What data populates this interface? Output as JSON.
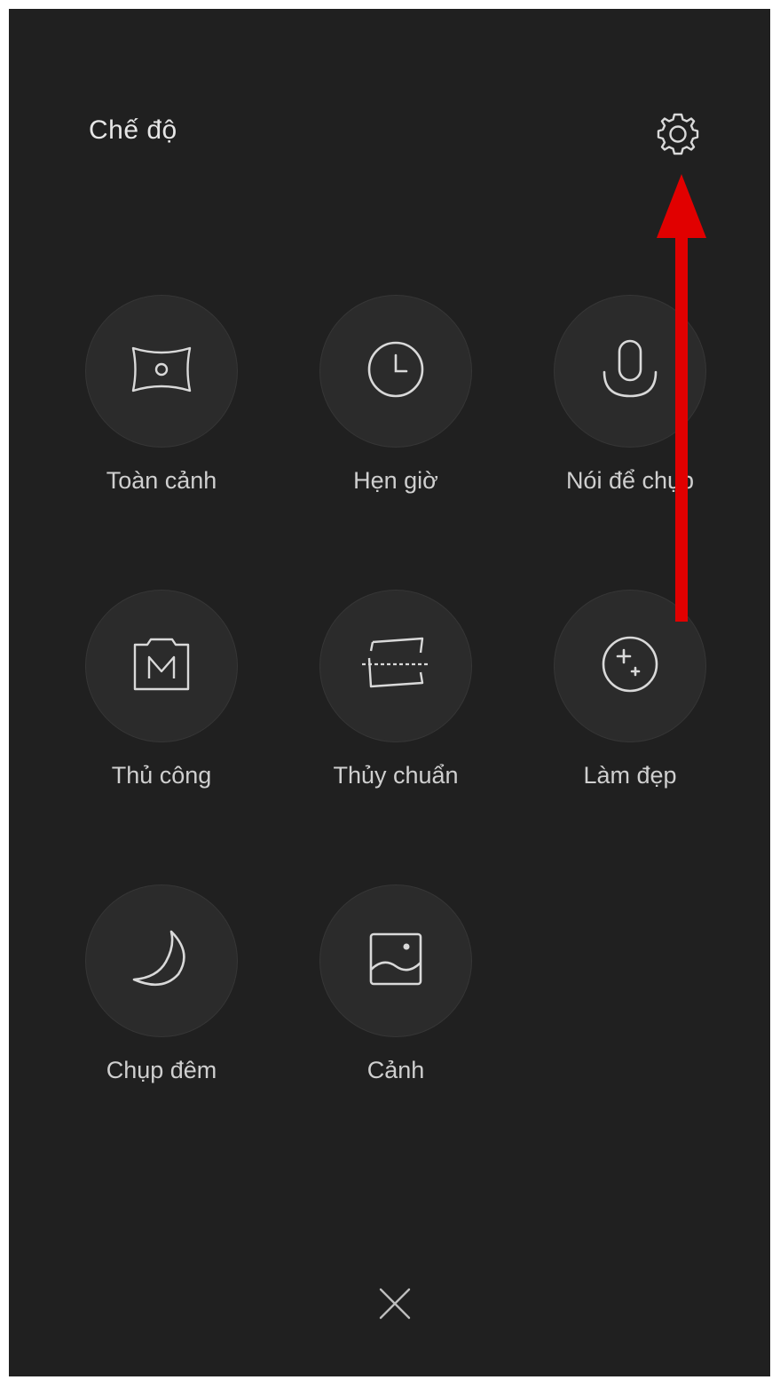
{
  "header": {
    "title": "Chế độ",
    "settings_icon": "gear-icon"
  },
  "modes": [
    {
      "label": "Toàn cảnh",
      "icon": "panorama-icon"
    },
    {
      "label": "Hẹn giờ",
      "icon": "clock-icon"
    },
    {
      "label": "Nói để chụp",
      "icon": "microphone-icon"
    },
    {
      "label": "Thủ công",
      "icon": "manual-camera-icon"
    },
    {
      "label": "Thủy chuẩn",
      "icon": "level-icon"
    },
    {
      "label": "Làm đẹp",
      "icon": "beautify-icon"
    },
    {
      "label": "Chụp đêm",
      "icon": "moon-icon"
    },
    {
      "label": "Cảnh",
      "icon": "landscape-icon"
    }
  ],
  "footer": {
    "close_icon": "close-icon"
  },
  "annotation": {
    "arrow_color": "#e10000",
    "arrow_icon": "arrow-up-icon"
  },
  "colors": {
    "background": "#202020",
    "circle": "#2b2b2b",
    "text": "#cfcfcf"
  }
}
